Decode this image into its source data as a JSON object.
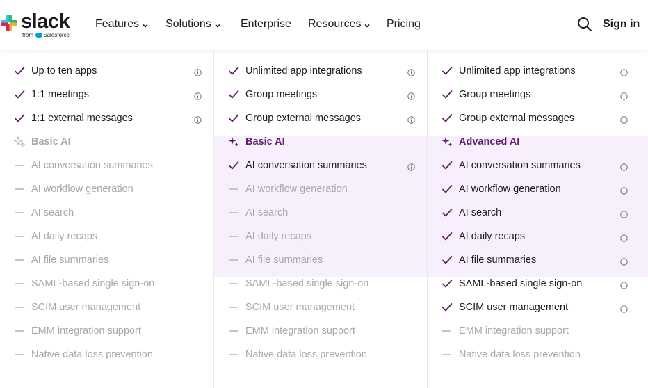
{
  "header": {
    "logo_word": "slack",
    "logo_from": "from",
    "logo_partner": "Salesforce",
    "nav": [
      {
        "label": "Features",
        "has_dropdown": true
      },
      {
        "label": "Solutions",
        "has_dropdown": true
      },
      {
        "label": "Enterprise",
        "has_dropdown": false
      },
      {
        "label": "Resources",
        "has_dropdown": true
      },
      {
        "label": "Pricing",
        "has_dropdown": false
      }
    ],
    "search_icon": "search-icon",
    "signin_label": "Sign in"
  },
  "colors": {
    "check": "#611f69",
    "ai_heading": "#611f69",
    "ai_band": "#f7effc",
    "disabled_text": "#a8a8a8",
    "dash": "#c6c6c6"
  },
  "columns": [
    {
      "rows": [
        {
          "label": "Up to ten apps",
          "state": "on",
          "info": true
        },
        {
          "label": "1:1 meetings",
          "state": "on",
          "info": true
        },
        {
          "label": "1:1 external messages",
          "state": "on",
          "info": true
        },
        {
          "label": "Basic AI",
          "state": "off",
          "heading": true,
          "info": false
        },
        {
          "label": "AI conversation summaries",
          "state": "off",
          "info": false
        },
        {
          "label": "AI workflow generation",
          "state": "off",
          "info": false
        },
        {
          "label": "AI search",
          "state": "off",
          "info": false
        },
        {
          "label": "AI daily recaps",
          "state": "off",
          "info": false
        },
        {
          "label": "AI file summaries",
          "state": "off",
          "info": false
        },
        {
          "label": "SAML-based single sign-on",
          "state": "off",
          "info": false
        },
        {
          "label": "SCIM user management",
          "state": "off",
          "info": false
        },
        {
          "label": "EMM integration support",
          "state": "off",
          "info": false
        },
        {
          "label": "Native data loss prevention",
          "state": "off",
          "info": false
        }
      ]
    },
    {
      "rows": [
        {
          "label": "Unlimited app integrations",
          "state": "on",
          "info": true
        },
        {
          "label": "Group meetings",
          "state": "on",
          "info": true
        },
        {
          "label": "Group external messages",
          "state": "on",
          "info": true
        },
        {
          "label": "Basic AI",
          "state": "on",
          "heading": true,
          "info": false
        },
        {
          "label": "AI conversation summaries",
          "state": "on",
          "info": true
        },
        {
          "label": "AI workflow generation",
          "state": "off",
          "info": false
        },
        {
          "label": "AI search",
          "state": "off",
          "info": false
        },
        {
          "label": "AI daily recaps",
          "state": "off",
          "info": false
        },
        {
          "label": "AI file summaries",
          "state": "off",
          "info": false
        },
        {
          "label": "SAML-based single sign-on",
          "state": "off",
          "info": false
        },
        {
          "label": "SCIM user management",
          "state": "off",
          "info": false
        },
        {
          "label": "EMM integration support",
          "state": "off",
          "info": false
        },
        {
          "label": "Native data loss prevention",
          "state": "off",
          "info": false
        }
      ]
    },
    {
      "rows": [
        {
          "label": "Unlimited app integrations",
          "state": "on",
          "info": true
        },
        {
          "label": "Group meetings",
          "state": "on",
          "info": true
        },
        {
          "label": "Group external messages",
          "state": "on",
          "info": true
        },
        {
          "label": "Advanced AI",
          "state": "on",
          "heading": true,
          "info": false
        },
        {
          "label": "AI conversation summaries",
          "state": "on",
          "info": true
        },
        {
          "label": "AI workflow generation",
          "state": "on",
          "info": true
        },
        {
          "label": "AI search",
          "state": "on",
          "info": true
        },
        {
          "label": "AI daily recaps",
          "state": "on",
          "info": true
        },
        {
          "label": "AI file summaries",
          "state": "on",
          "info": true
        },
        {
          "label": "SAML-based single sign-on",
          "state": "on",
          "info": true
        },
        {
          "label": "SCIM user management",
          "state": "on",
          "info": true
        },
        {
          "label": "EMM integration support",
          "state": "off",
          "info": false
        },
        {
          "label": "Native data loss prevention",
          "state": "off",
          "info": false
        }
      ]
    }
  ]
}
